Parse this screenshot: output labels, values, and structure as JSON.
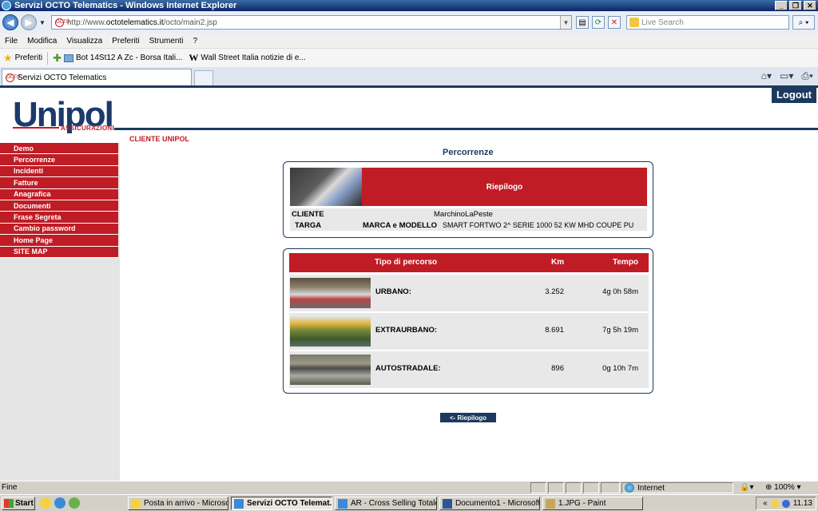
{
  "window": {
    "title": "Servizi OCTO Telematics - Windows Internet Explorer"
  },
  "address": {
    "url_prefix": "http://www.",
    "url_host": "octotelematics.it",
    "url_path": "/octo/main2.jsp",
    "search_placeholder": "Live Search"
  },
  "menu": [
    "File",
    "Modifica",
    "Visualizza",
    "Preferiti",
    "Strumenti",
    "?"
  ],
  "favorites": {
    "label": "Preferiti",
    "items": [
      "Bot 14St12 A Zc - Borsa Itali...",
      "Wall Street Italia notizie di e..."
    ]
  },
  "tab": {
    "label": "Servizi OCTO Telematics"
  },
  "page": {
    "logo_main": "Unipol",
    "logo_sub": "ASSICURAZIONI",
    "logout": "Logout",
    "cliente_label": "CLIENTE UNIPOL",
    "title": "Percorrenze",
    "sidebar": [
      "Demo",
      "Percorrenze",
      "Incidenti",
      "Fatture",
      "Anagrafica",
      "Documenti",
      "Frase Segreta",
      "Cambio password",
      "Home Page",
      "SITE MAP"
    ],
    "summary": {
      "header": "Riepilogo",
      "cliente_key": "CLIENTE",
      "cliente_val": "MarchinoLaPeste",
      "targa_key": "TARGA",
      "marca_key": "MARCA e MODELLO",
      "marca_val": "SMART FORTWO 2^ SERIE 1000 52 KW MHD COUPE PU"
    },
    "trips": {
      "col_type": "Tipo di percorso",
      "col_km": "Km",
      "col_time": "Tempo",
      "rows": [
        {
          "type": "URBANO:",
          "km": "3.252",
          "time": "4g 0h 58m"
        },
        {
          "type": "EXTRAURBANO:",
          "km": "8.691",
          "time": "7g 5h 19m"
        },
        {
          "type": "AUTOSTRADALE:",
          "km": "896",
          "time": "0g 10h 7m"
        }
      ]
    },
    "back_button": "<- Riepilogo"
  },
  "status": {
    "text": "Fine",
    "zone": "Internet",
    "zoom": "100%"
  },
  "taskbar": {
    "start": "Start",
    "tasks": [
      "Posta in arrivo - Microsof...",
      "Servizi OCTO Telemat...",
      "AR - Cross Selling Totale ...",
      "Documento1 - Microsoft ...",
      "1.JPG - Paint"
    ],
    "clock": "11.13"
  },
  "colors": {
    "brand_red": "#c01c25",
    "brand_blue": "#1b3a5e"
  }
}
